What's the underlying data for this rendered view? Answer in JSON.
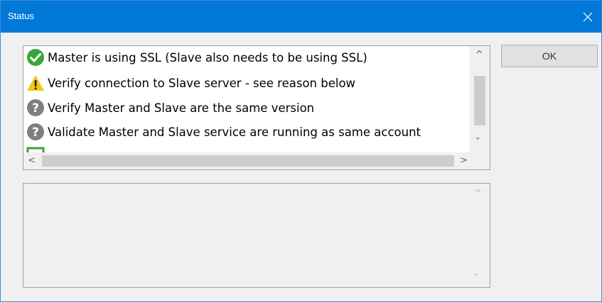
{
  "window": {
    "title": "Status"
  },
  "status_list": {
    "items": [
      {
        "icon": "success-check-icon",
        "label": "Master is using SSL (Slave also needs to be using SSL)"
      },
      {
        "icon": "warning-icon",
        "label": "Verify connection to Slave server - see reason below"
      },
      {
        "icon": "question-icon",
        "label": "Verify Master and Slave are the same version"
      },
      {
        "icon": "question-icon",
        "label": "Validate Master and Slave service are running as same account"
      },
      {
        "icon": "pending-box-icon",
        "label": ""
      }
    ]
  },
  "buttons": {
    "ok_label": "OK"
  },
  "details": {
    "text": ""
  },
  "colors": {
    "titlebar": "#0078d7",
    "success": "#3aa53a",
    "warning": "#f2c811",
    "question": "#7f7f7f"
  }
}
